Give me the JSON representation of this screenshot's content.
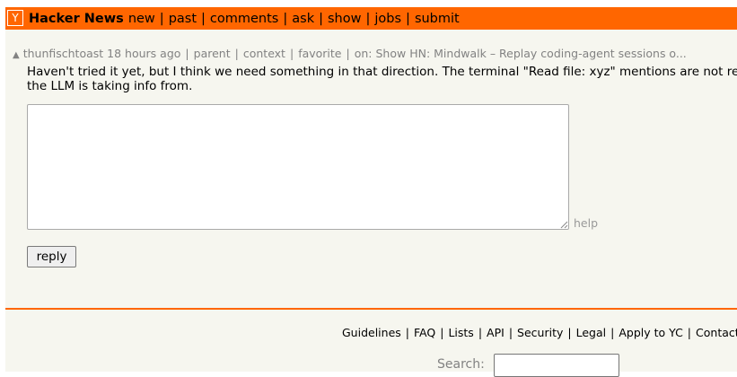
{
  "header": {
    "logo": "Y",
    "brand": "Hacker News",
    "nav": [
      "new",
      "past",
      "comments",
      "ask",
      "show",
      "jobs",
      "submit"
    ]
  },
  "comment": {
    "vote_arrow": "▲",
    "user": "thunfischtoast",
    "age": "18 hours ago",
    "links": [
      "parent",
      "context",
      "favorite"
    ],
    "on_prefix": "on:",
    "story": "Show HN: Mindwalk – Replay coding-agent sessions o...",
    "text_line1": "Haven't tried it yet, but I think we need something in that direction. The terminal \"Read file: xyz\" mentions are not reall",
    "text_line2": "the LLM is taking info from."
  },
  "reply_form": {
    "textarea_value": "",
    "help_label": "help",
    "button_label": "reply"
  },
  "footer": {
    "links": [
      "Guidelines",
      "FAQ",
      "Lists",
      "API",
      "Security",
      "Legal",
      "Apply to YC",
      "Contact"
    ],
    "search_label": "Search:",
    "search_value": ""
  },
  "colors": {
    "accent": "#ff6600",
    "background": "#f6f6ef",
    "muted_text": "#828282"
  }
}
